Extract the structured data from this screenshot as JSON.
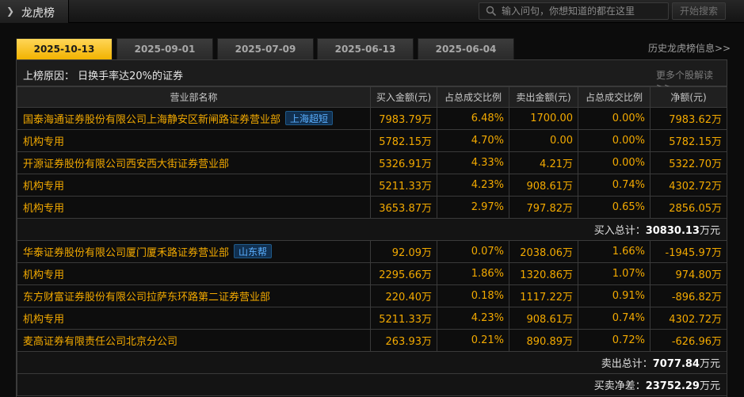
{
  "header": {
    "title": "龙虎榜",
    "search_placeholder": "输入问句，你想知道的都在这里",
    "search_button": "开始搜索"
  },
  "tabs": [
    {
      "label": "2025-10-13",
      "active": true
    },
    {
      "label": "2025-09-01",
      "active": false
    },
    {
      "label": "2025-07-09",
      "active": false
    },
    {
      "label": "2025-06-13",
      "active": false
    },
    {
      "label": "2025-06-04",
      "active": false
    }
  ],
  "history_link": "历史龙虎榜信息>>",
  "reason": {
    "label": "上榜原因：  日换手率达20%的证券",
    "more_link": "更多个股解读>>"
  },
  "table": {
    "columns": [
      "营业部名称",
      "买入金额(元)",
      "占总成交比例",
      "卖出金额(元)",
      "占总成交比例",
      "净额(元)"
    ],
    "buy_rows": [
      {
        "name": "国泰海通证券股份有限公司上海静安区新闸路证券营业部",
        "badge": "上海超短",
        "buy": "7983.79万",
        "buy_pct": "6.48%",
        "sell": "1700.00",
        "sell_pct": "0.00%",
        "net": "7983.62万"
      },
      {
        "name": "机构专用",
        "badge": "",
        "buy": "5782.15万",
        "buy_pct": "4.70%",
        "sell": "0.00",
        "sell_pct": "0.00%",
        "net": "5782.15万"
      },
      {
        "name": "开源证券股份有限公司西安西大街证券营业部",
        "badge": "",
        "buy": "5326.91万",
        "buy_pct": "4.33%",
        "sell": "4.21万",
        "sell_pct": "0.00%",
        "net": "5322.70万"
      },
      {
        "name": "机构专用",
        "badge": "",
        "buy": "5211.33万",
        "buy_pct": "4.23%",
        "sell": "908.61万",
        "sell_pct": "0.74%",
        "net": "4302.72万"
      },
      {
        "name": "机构专用",
        "badge": "",
        "buy": "3653.87万",
        "buy_pct": "2.97%",
        "sell": "797.82万",
        "sell_pct": "0.65%",
        "net": "2856.05万"
      }
    ],
    "buy_total_label": "买入总计：",
    "buy_total_value": "30830.13",
    "buy_total_unit": "万元",
    "sell_rows": [
      {
        "name": "华泰证券股份有限公司厦门厦禾路证券营业部",
        "badge": "山东帮",
        "buy": "92.09万",
        "buy_pct": "0.07%",
        "sell": "2038.06万",
        "sell_pct": "1.66%",
        "net": "-1945.97万"
      },
      {
        "name": "机构专用",
        "badge": "",
        "buy": "2295.66万",
        "buy_pct": "1.86%",
        "sell": "1320.86万",
        "sell_pct": "1.07%",
        "net": "974.80万"
      },
      {
        "name": "东方财富证券股份有限公司拉萨东环路第二证券营业部",
        "badge": "",
        "buy": "220.40万",
        "buy_pct": "0.18%",
        "sell": "1117.22万",
        "sell_pct": "0.91%",
        "net": "-896.82万"
      },
      {
        "name": "机构专用",
        "badge": "",
        "buy": "5211.33万",
        "buy_pct": "4.23%",
        "sell": "908.61万",
        "sell_pct": "0.74%",
        "net": "4302.72万"
      },
      {
        "name": "麦高证券有限责任公司北京分公司",
        "badge": "",
        "buy": "263.93万",
        "buy_pct": "0.21%",
        "sell": "890.89万",
        "sell_pct": "0.72%",
        "net": "-626.96万"
      }
    ],
    "sell_total_label": "卖出总计：",
    "sell_total_value": "7077.84",
    "sell_total_unit": "万元",
    "net_label": "买卖净差：",
    "net_value": "23752.29",
    "net_unit": "万元"
  },
  "colors": {
    "accent": "#f2a900",
    "active_tab": "#f2b300",
    "badge_text": "#5bb0ff",
    "background": "#0c0c0c"
  }
}
